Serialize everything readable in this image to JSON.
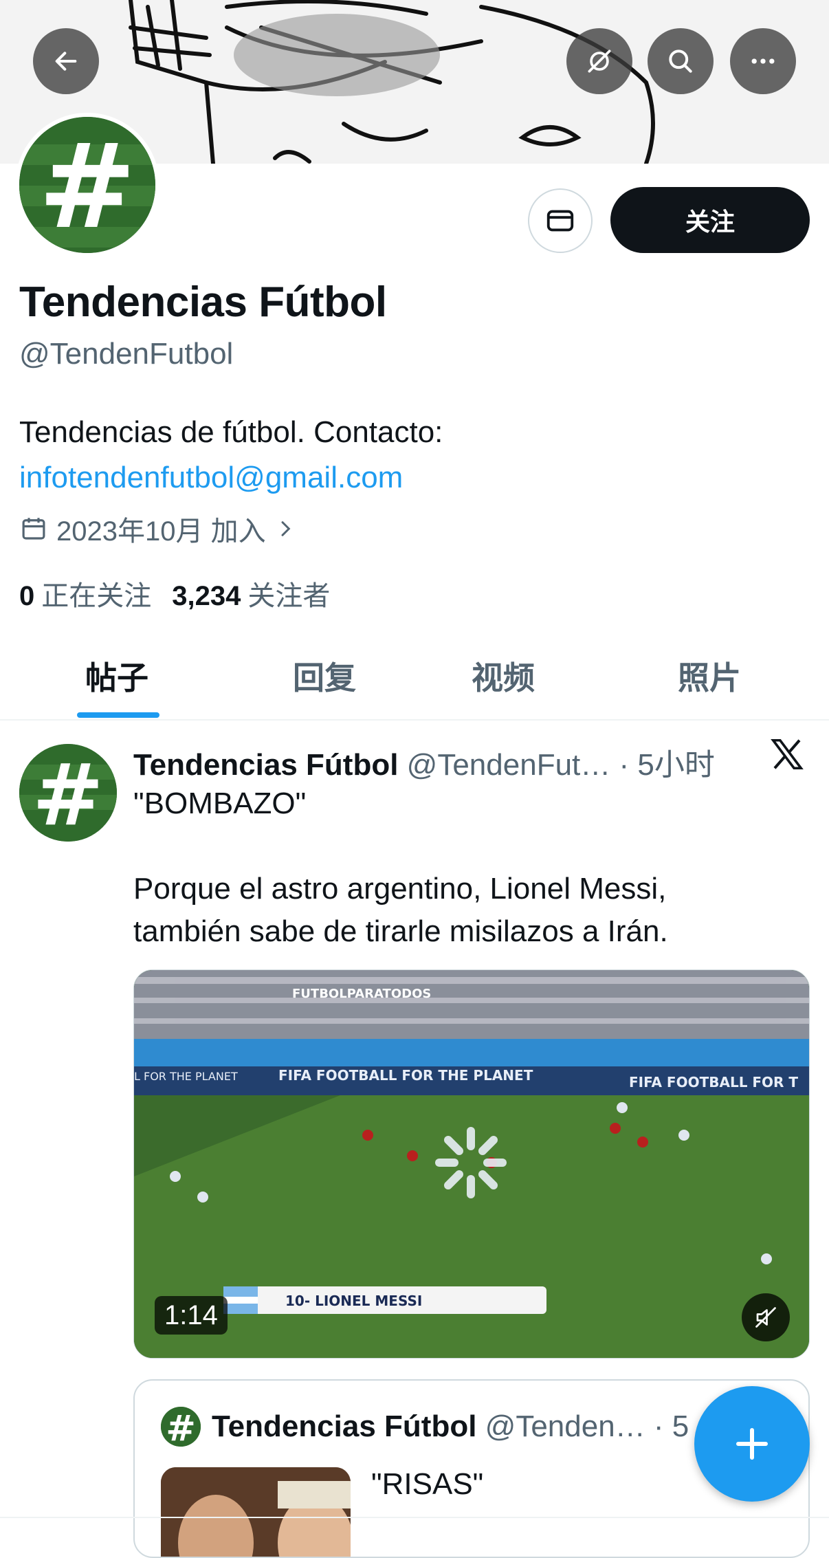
{
  "profile": {
    "name": "Tendencias Fútbol",
    "handle": "@TendenFutbol",
    "bio_text": "Tendencias de fútbol. Contacto:",
    "bio_link": "infotendenfutbol@gmail.com",
    "joined": "2023年10月 加入",
    "following_count": "0",
    "following_label": "正在关注",
    "followers_count": "3,234",
    "followers_label": "关注者",
    "follow_button": "关注",
    "avatar_symbol": "#"
  },
  "tabs": [
    {
      "label": "帖子",
      "active": true
    },
    {
      "label": "回复",
      "active": false
    },
    {
      "label": "视频",
      "active": false
    },
    {
      "label": "照片",
      "active": false
    }
  ],
  "post": {
    "name": "Tendencias Fútbol",
    "handle_time": "@TendenFut… · 5小时",
    "text": "\"BOMBAZO\"\n\nPorque el astro argentino, Lionel Messi,\ntambién sabe de tirarle misilazos a Irán.",
    "video_duration": "1:14",
    "video_board_left": "FUTBOLPARATODOS",
    "video_board_1": "FIFA  FOOTBALL FOR THE PLANET",
    "video_board_2": "FIFA  FOOTBALL FOR T",
    "video_board_3": "L FOR THE PLANET",
    "video_caption": "10- LIONEL MESSI"
  },
  "quote": {
    "name": "Tendencias Fútbol",
    "handle_time": "@Tenden… · 5",
    "text": "\"RISAS\""
  },
  "colors": {
    "accent": "#1d9bf0",
    "text": "#0f1419",
    "muted": "#536471",
    "avatar_green": "#2f6b2c"
  }
}
